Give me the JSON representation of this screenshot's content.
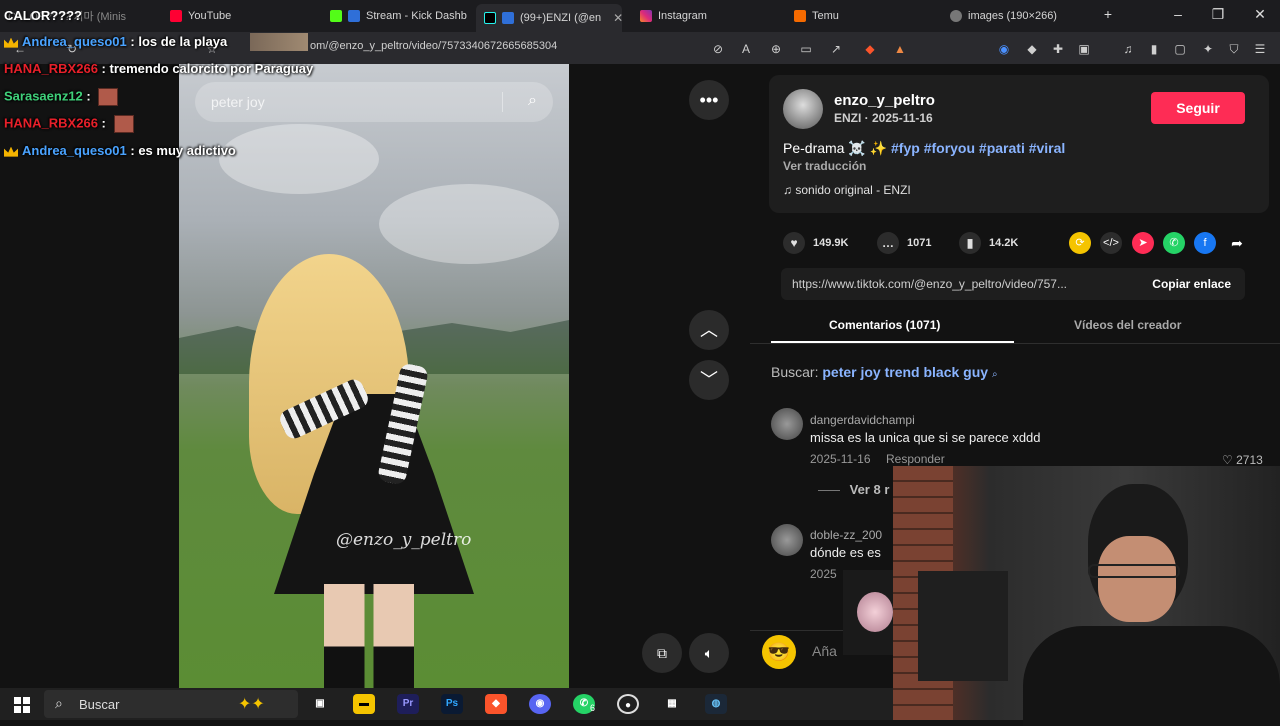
{
  "browser": {
    "tabs": [
      {
        "label": "CALOR???? 치마 (Minis",
        "icon": "kick-icon"
      },
      {
        "label": "YouTube",
        "icon": "youtube-icon"
      },
      {
        "label": "Stream - Kick Dashb",
        "icon": "kick-icon"
      },
      {
        "label": "(99+)ENZI (@en",
        "icon": "tiktok-icon",
        "active": true
      },
      {
        "label": "Instagram",
        "icon": "instagram-icon"
      },
      {
        "label": "Temu",
        "icon": "temu-icon"
      },
      {
        "label": "images (190×266)",
        "icon": "globe-icon"
      }
    ],
    "url": "om/@enzo_y_peltro/video/7573340672665685304",
    "brave_badge": "1",
    "vpn_badge": "160"
  },
  "stream_title": "CALOR????",
  "chat": [
    {
      "user": "Andrea_queso01",
      "msg": ": los de la playa",
      "color": "#4aa3ff",
      "crown": true
    },
    {
      "user": "HANA_RBX266",
      "msg": ": tremendo calorcito por Paraguay",
      "color": "#e8202a",
      "crown": false
    },
    {
      "user": "Sarasaenz12",
      "msg": ":",
      "color": "#3fd07a",
      "crown": false
    },
    {
      "user": "HANA_RBX266",
      "msg": ":",
      "color": "#e8202a",
      "crown": false
    },
    {
      "user": "Andrea_queso01",
      "msg": ": es muy adictivo",
      "color": "#4aa3ff",
      "crown": true
    }
  ],
  "video": {
    "search_placeholder": "peter joy",
    "watermark": "@enzo_y_peltro"
  },
  "post": {
    "author": "enzo_y_peltro",
    "meta": "ENZI · 2025-11-16",
    "follow": "Seguir",
    "caption": "Pe-drama ☠️ ✨",
    "tags": "#fyp #foryou #parati #viral",
    "translate": "Ver traducción",
    "sound": "sonido original - ENZI",
    "likes": "149.9K",
    "comments": "1071",
    "saves": "14.2K",
    "link": "https://www.tiktok.com/@enzo_y_peltro/video/757...",
    "copy": "Copiar enlace"
  },
  "tabs": {
    "comments": "Comentarios (1071)",
    "creator": "Vídeos del creador"
  },
  "suggest": {
    "label": "Buscar:",
    "query": "peter joy trend black guy"
  },
  "comments": [
    {
      "user": "dangerdavidchampi",
      "text": "missa es la unica que si se parece xddd",
      "date": "2025-11-16",
      "reply": "Responder",
      "likes": "2713"
    },
    {
      "user": "doble-zz_200",
      "text": "dónde es es",
      "date": "2025",
      "reply": "",
      "likes": ""
    }
  ],
  "view_more": "Ver 8 r",
  "add_comment": "Aña",
  "taskbar": {
    "search": "Buscar",
    "whatsapp_badge": "6"
  }
}
